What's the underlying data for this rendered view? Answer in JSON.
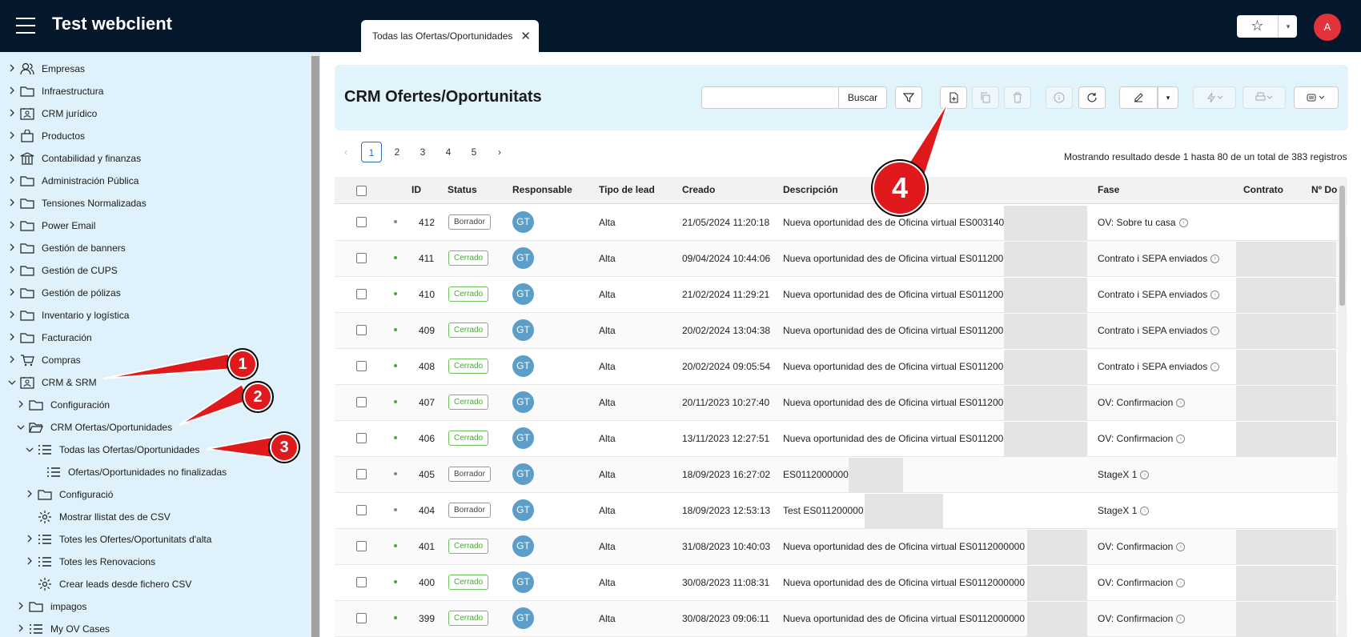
{
  "app": {
    "title": "Test webclient",
    "user_initial": "A"
  },
  "tab": {
    "label": "Todas las Ofertas/Oportunidades"
  },
  "sidebar": {
    "items": [
      {
        "label": "Empresas",
        "icon": "users-icon"
      },
      {
        "label": "Infraestructura",
        "icon": "folder-icon"
      },
      {
        "label": "CRM jurídico",
        "icon": "contact-card-icon"
      },
      {
        "label": "Productos",
        "icon": "bag-icon"
      },
      {
        "label": "Contabilidad y finanzas",
        "icon": "bank-icon"
      },
      {
        "label": "Administración Pública",
        "icon": "folder-icon"
      },
      {
        "label": "Tensiones Normalizadas",
        "icon": "folder-icon"
      },
      {
        "label": "Power Email",
        "icon": "folder-icon"
      },
      {
        "label": "Gestión de banners",
        "icon": "folder-icon"
      },
      {
        "label": "Gestión de CUPS",
        "icon": "folder-icon"
      },
      {
        "label": "Gestión de pólizas",
        "icon": "folder-icon"
      },
      {
        "label": "Inventario y logística",
        "icon": "folder-icon"
      },
      {
        "label": "Facturación",
        "icon": "folder-icon"
      },
      {
        "label": "Compras",
        "icon": "cart-icon"
      },
      {
        "label": "CRM & SRM",
        "icon": "contact-card-icon"
      },
      {
        "label": "Configuración",
        "icon": "folder-icon"
      },
      {
        "label": "CRM Ofertas/Oportunidades",
        "icon": "folder-open-icon"
      },
      {
        "label": "Todas las Ofertas/Oportunidades",
        "icon": "list-icon"
      },
      {
        "label": "Ofertas/Oportunidades no finalizadas",
        "icon": "list-icon"
      },
      {
        "label": "Configuració",
        "icon": "folder-icon"
      },
      {
        "label": "Mostrar llistat des de CSV",
        "icon": "gear-icon"
      },
      {
        "label": "Totes les Ofertes/Oportunitats d'alta",
        "icon": "list-icon"
      },
      {
        "label": "Totes les Renovacions",
        "icon": "list-icon"
      },
      {
        "label": "Crear leads desde fichero CSV",
        "icon": "gear-icon"
      },
      {
        "label": "impagos",
        "icon": "folder-icon"
      },
      {
        "label": "My OV Cases",
        "icon": "list-icon"
      }
    ]
  },
  "main": {
    "title": "CRM Ofertes/Oportunitats",
    "search": {
      "value": "",
      "button": "Buscar"
    },
    "pagination": {
      "prev": "‹",
      "next": "›",
      "pages": [
        "1",
        "2",
        "3",
        "4",
        "5"
      ],
      "active": "1"
    },
    "records_info": "Mostrando resultado desde 1 hasta 80 de un total de 383 registros"
  },
  "table": {
    "columns": [
      "ID",
      "Status",
      "Responsable",
      "Tipo de lead",
      "Creado",
      "Descripción",
      "Fase",
      "Contrato",
      "Nº Do"
    ],
    "rows": [
      {
        "id": "412",
        "status": "Borrador",
        "resp": "GT",
        "tipo": "Alta",
        "creado": "21/05/2024 11:20:18",
        "desc": "Nueva oportunidad des de Oficina virtual ES003140",
        "fase": "OV: Sobre tu casa"
      },
      {
        "id": "411",
        "status": "Cerrado",
        "resp": "GT",
        "tipo": "Alta",
        "creado": "09/04/2024 10:44:06",
        "desc": "Nueva oportunidad des de Oficina virtual ES011200",
        "fase": "Contrato i SEPA enviados"
      },
      {
        "id": "410",
        "status": "Cerrado",
        "resp": "GT",
        "tipo": "Alta",
        "creado": "21/02/2024 11:29:21",
        "desc": "Nueva oportunidad des de Oficina virtual ES011200",
        "fase": "Contrato i SEPA enviados"
      },
      {
        "id": "409",
        "status": "Cerrado",
        "resp": "GT",
        "tipo": "Alta",
        "creado": "20/02/2024 13:04:38",
        "desc": "Nueva oportunidad des de Oficina virtual ES011200",
        "fase": "Contrato i SEPA enviados"
      },
      {
        "id": "408",
        "status": "Cerrado",
        "resp": "GT",
        "tipo": "Alta",
        "creado": "20/02/2024 09:05:54",
        "desc": "Nueva oportunidad des de Oficina virtual ES011200",
        "fase": "Contrato i SEPA enviados"
      },
      {
        "id": "407",
        "status": "Cerrado",
        "resp": "GT",
        "tipo": "Alta",
        "creado": "20/11/2023 10:27:40",
        "desc": "Nueva oportunidad des de Oficina virtual ES011200",
        "fase": "OV: Confirmacion"
      },
      {
        "id": "406",
        "status": "Cerrado",
        "resp": "GT",
        "tipo": "Alta",
        "creado": "13/11/2023 12:27:51",
        "desc": "Nueva oportunidad des de Oficina virtual ES011200",
        "fase": "OV: Confirmacion"
      },
      {
        "id": "405",
        "status": "Borrador",
        "resp": "GT",
        "tipo": "Alta",
        "creado": "18/09/2023 16:27:02",
        "desc": "ES0112000000",
        "fase": "StageX 1"
      },
      {
        "id": "404",
        "status": "Borrador",
        "resp": "GT",
        "tipo": "Alta",
        "creado": "18/09/2023 12:53:13",
        "desc": "Test ES011200000",
        "fase": "StageX 1"
      },
      {
        "id": "401",
        "status": "Cerrado",
        "resp": "GT",
        "tipo": "Alta",
        "creado": "31/08/2023 10:40:03",
        "desc": "Nueva oportunidad des de Oficina virtual ES0112000000",
        "fase": "OV: Confirmacion"
      },
      {
        "id": "400",
        "status": "Cerrado",
        "resp": "GT",
        "tipo": "Alta",
        "creado": "30/08/2023 11:08:31",
        "desc": "Nueva oportunidad des de Oficina virtual ES0112000000",
        "fase": "OV: Confirmacion"
      },
      {
        "id": "399",
        "status": "Cerrado",
        "resp": "GT",
        "tipo": "Alta",
        "creado": "30/08/2023 09:06:11",
        "desc": "Nueva oportunidad des de Oficina virtual ES0112000000",
        "fase": "OV: Confirmacion"
      }
    ]
  },
  "annotations": [
    "1",
    "2",
    "3",
    "4"
  ],
  "colors": {
    "topbar": "#05172b",
    "sidebar": "#dff1fa",
    "header_card": "#e1f3fb",
    "callout": "#e0191c",
    "cerrado": "#4ea63c",
    "avatar": "#5a9ec9"
  }
}
